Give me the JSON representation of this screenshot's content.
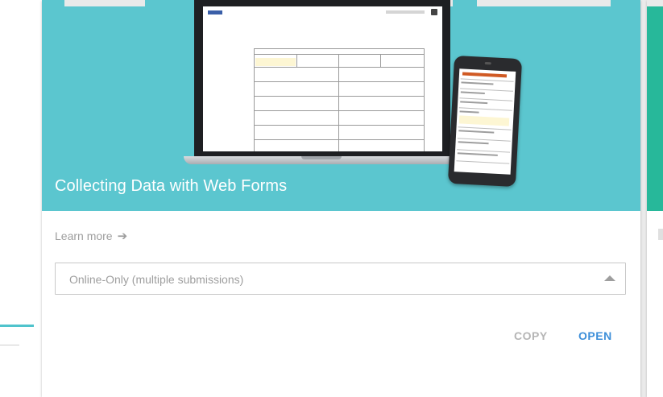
{
  "card": {
    "title": "Collecting Data with Web Forms",
    "learn_more": "Learn more",
    "learn_more_icon": "arrow-right-icon",
    "select": {
      "value": "Online-Only (multiple submissions)",
      "icon": "caret-up-icon"
    },
    "actions": {
      "copy": "COPY",
      "open": "OPEN"
    }
  },
  "colors": {
    "header_bg": "#5bc6cf",
    "accent_blue": "#3d8fd9",
    "muted_text": "#9e9e9e",
    "doc_title": "#d05a24"
  }
}
